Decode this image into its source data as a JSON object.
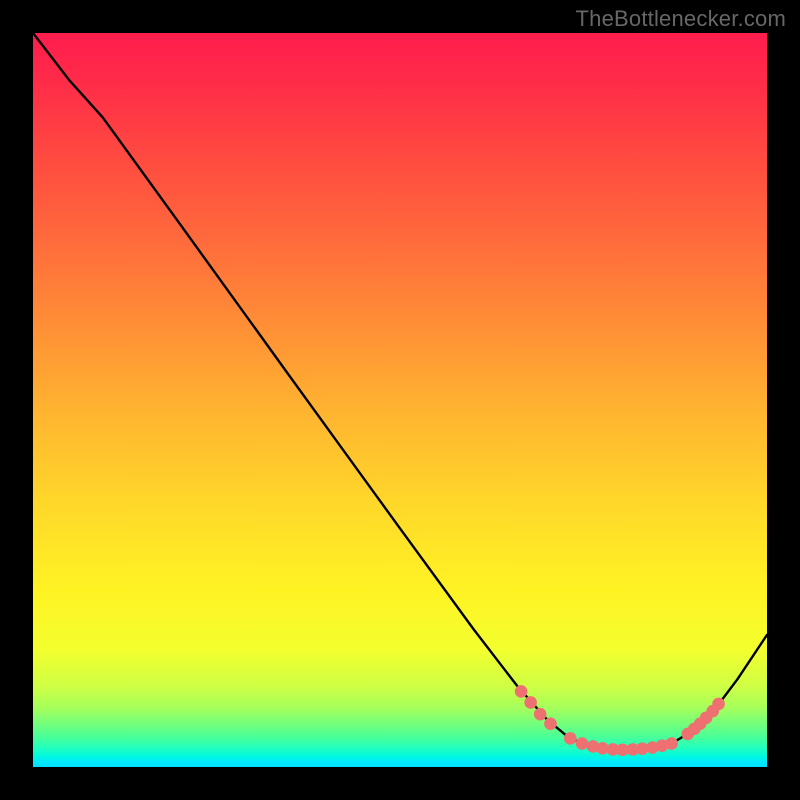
{
  "watermark": "TheBottlenecker.com",
  "chart_data": {
    "type": "line",
    "title": "",
    "xlabel": "",
    "ylabel": "",
    "xlim": [
      0,
      100
    ],
    "ylim": [
      0,
      100
    ],
    "curve_points": [
      {
        "x": 0.0,
        "y": 100.0
      },
      {
        "x": 5.0,
        "y": 93.5
      },
      {
        "x": 9.5,
        "y": 88.5
      },
      {
        "x": 20.0,
        "y": 74.0
      },
      {
        "x": 35.0,
        "y": 53.2
      },
      {
        "x": 50.0,
        "y": 32.5
      },
      {
        "x": 60.0,
        "y": 18.8
      },
      {
        "x": 66.0,
        "y": 11.0
      },
      {
        "x": 70.0,
        "y": 6.5
      },
      {
        "x": 73.0,
        "y": 4.0
      },
      {
        "x": 76.0,
        "y": 2.7
      },
      {
        "x": 80.0,
        "y": 2.3
      },
      {
        "x": 84.0,
        "y": 2.5
      },
      {
        "x": 87.0,
        "y": 3.2
      },
      {
        "x": 90.0,
        "y": 5.0
      },
      {
        "x": 93.0,
        "y": 8.0
      },
      {
        "x": 96.0,
        "y": 12.0
      },
      {
        "x": 100.0,
        "y": 18.0
      }
    ],
    "dots": [
      {
        "x": 66.5,
        "y": 10.3
      },
      {
        "x": 67.8,
        "y": 8.8
      },
      {
        "x": 69.1,
        "y": 7.2
      },
      {
        "x": 70.5,
        "y": 5.9
      },
      {
        "x": 73.2,
        "y": 3.9
      },
      {
        "x": 74.8,
        "y": 3.2
      },
      {
        "x": 76.3,
        "y": 2.8
      },
      {
        "x": 77.6,
        "y": 2.55
      },
      {
        "x": 79.0,
        "y": 2.4
      },
      {
        "x": 80.3,
        "y": 2.35
      },
      {
        "x": 81.7,
        "y": 2.4
      },
      {
        "x": 83.0,
        "y": 2.5
      },
      {
        "x": 84.4,
        "y": 2.65
      },
      {
        "x": 85.7,
        "y": 2.9
      },
      {
        "x": 87.0,
        "y": 3.2
      },
      {
        "x": 89.2,
        "y": 4.5
      },
      {
        "x": 90.1,
        "y": 5.2
      },
      {
        "x": 90.9,
        "y": 5.9
      },
      {
        "x": 91.7,
        "y": 6.7
      },
      {
        "x": 92.6,
        "y": 7.6
      },
      {
        "x": 93.4,
        "y": 8.6
      }
    ],
    "curve_color": "#000000",
    "dot_color": "#ee7070",
    "background_gradient": {
      "top": "#ff1d4e",
      "middle": "#fff324",
      "bottom": "#00dfff"
    }
  }
}
